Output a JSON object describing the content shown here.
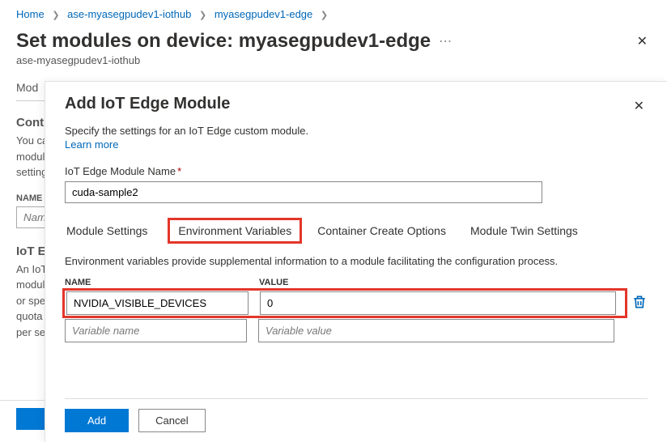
{
  "breadcrumbs": {
    "items": [
      "Home",
      "ase-myasegpudev1-iothub",
      "myasegpudev1-edge"
    ]
  },
  "header": {
    "title": "Set modules on device: myasegpudev1-edge",
    "subtitle": "ase-myasegpudev1-iothub"
  },
  "bg": {
    "tab_label": "Mod",
    "section_title": "Cont",
    "desc": "You ca\nmodul\nsetting",
    "name_label": "NAME",
    "name_placeholder": "Nam",
    "iot_section": "IoT E",
    "iot_desc": "An IoT\nmodul\nor spe\nquota\nper se"
  },
  "panel": {
    "title": "Add IoT Edge Module",
    "desc": "Specify the settings for an IoT Edge custom module.",
    "learn_more": "Learn more",
    "module_name_label": "IoT Edge Module Name",
    "module_name_value": "cuda-sample2",
    "tabs": {
      "settings": "Module Settings",
      "env": "Environment Variables",
      "create": "Container Create Options",
      "twin": "Module Twin Settings"
    },
    "env_desc": "Environment variables provide supplemental information to a module facilitating the configuration process.",
    "cols": {
      "name": "NAME",
      "value": "VALUE"
    },
    "rows": [
      {
        "name": "NVIDIA_VISIBLE_DEVICES",
        "value": "0"
      }
    ],
    "placeholders": {
      "name": "Variable name",
      "value": "Variable value"
    },
    "buttons": {
      "add": "Add",
      "cancel": "Cancel"
    }
  }
}
